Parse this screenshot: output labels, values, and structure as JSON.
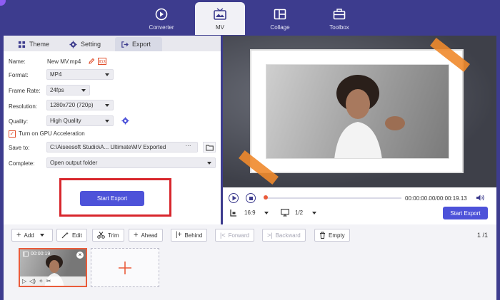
{
  "nav": {
    "items": [
      {
        "label": "Converter",
        "icon": "converter-icon",
        "active": false
      },
      {
        "label": "MV",
        "icon": "mv-icon",
        "active": true
      },
      {
        "label": "Collage",
        "icon": "collage-icon",
        "active": false
      },
      {
        "label": "Toolbox",
        "icon": "toolbox-icon",
        "active": false
      }
    ]
  },
  "tabs": {
    "theme": "Theme",
    "setting": "Setting",
    "export": "Export"
  },
  "export_form": {
    "name_label": "Name:",
    "name_value": "New MV.mp4",
    "format_label": "Format:",
    "format_value": "MP4",
    "frame_rate_label": "Frame Rate:",
    "frame_rate_value": "24fps",
    "resolution_label": "Resolution:",
    "resolution_value": "1280x720 (720p)",
    "quality_label": "Quality:",
    "quality_value": "High Quality",
    "gpu_label": "Turn on GPU Acceleration",
    "gpu_checked": true,
    "save_to_label": "Save to:",
    "save_to_value": "C:\\Aiseesoft Studio\\A... Ultimate\\MV Exported",
    "browse_label": "···",
    "complete_label": "Complete:",
    "complete_value": "Open output folder",
    "start_export": "Start Export"
  },
  "player": {
    "time": "00:00:00.00/00:00:19.13",
    "aspect": "16:9",
    "page": "1/2",
    "start_export": "Start Export",
    "progress": 0
  },
  "toolbar": {
    "add": "Add",
    "edit": "Edit",
    "trim": "Trim",
    "ahead": "Ahead",
    "behind": "Behind",
    "forward": "Forward",
    "backward": "Backward",
    "empty": "Empty",
    "page_count": "1 /1"
  },
  "clip": {
    "time": "00:00:19"
  },
  "colors": {
    "brand": "#3d3c8e",
    "accent_button": "#4d52d9",
    "highlight": "#d8262c",
    "orange": "#ea5b3a"
  }
}
